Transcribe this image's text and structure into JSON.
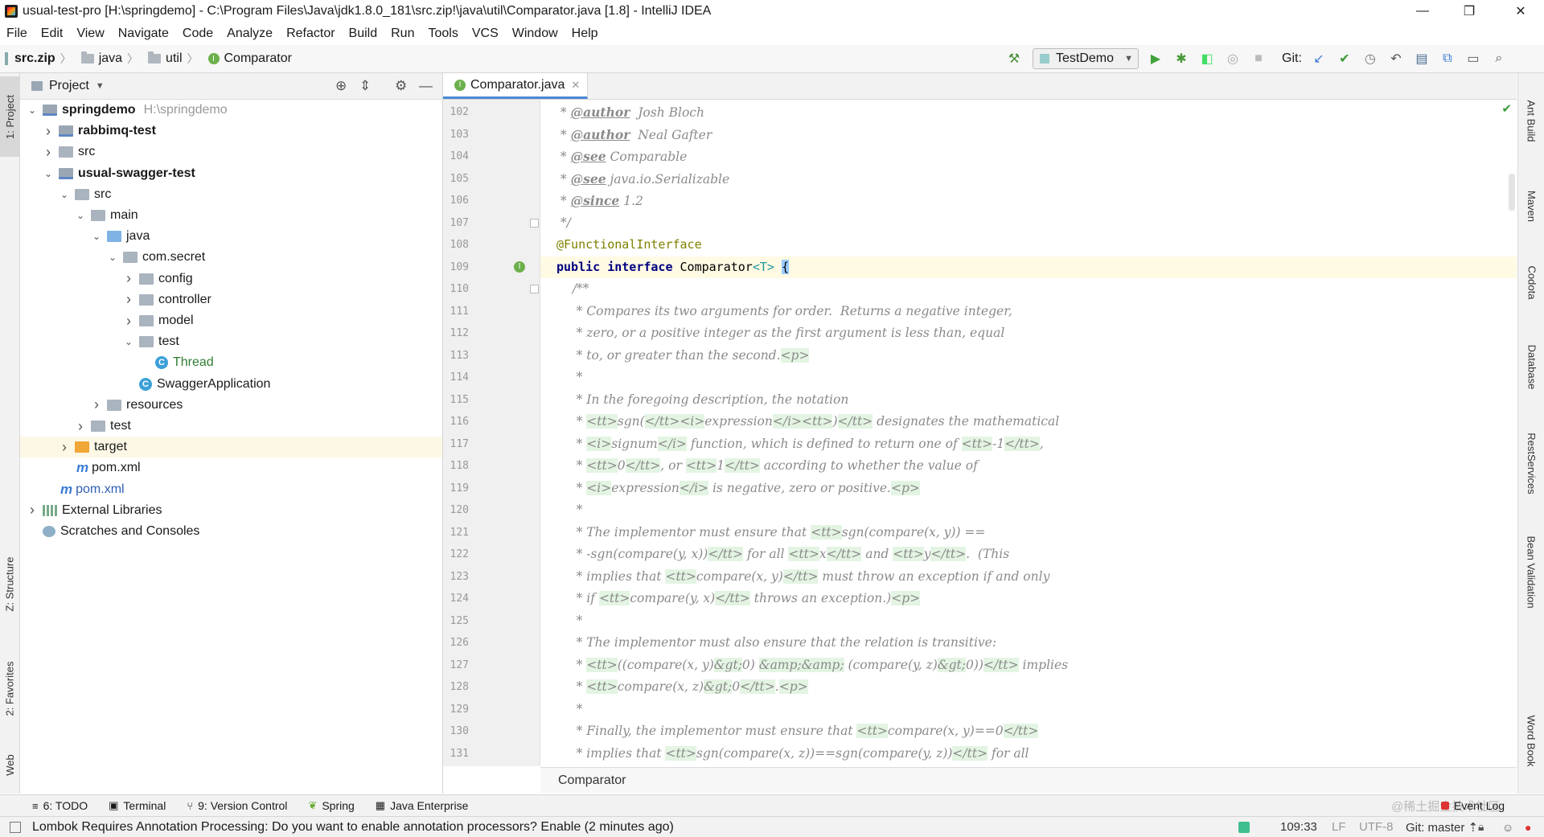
{
  "window": {
    "title": "usual-test-pro [H:\\springdemo] - C:\\Program Files\\Java\\jdk1.8.0_181\\src.zip!\\java\\util\\Comparator.java [1.8] - IntelliJ IDEA",
    "minimize": "—",
    "maximize": "❐",
    "close": "✕"
  },
  "menu": [
    "File",
    "Edit",
    "View",
    "Navigate",
    "Code",
    "Analyze",
    "Refactor",
    "Build",
    "Run",
    "Tools",
    "VCS",
    "Window",
    "Help"
  ],
  "nav": {
    "crumbs": [
      "src.zip",
      "java",
      "util",
      "Comparator"
    ],
    "run_config": "TestDemo",
    "git_label": "Git:"
  },
  "left_tools": [
    "1: Project",
    "Z: Structure",
    "2: Favorites",
    "Web"
  ],
  "project": {
    "header": "Project",
    "tree": [
      {
        "label": "springdemo",
        "extra": "H:\\springdemo",
        "depth": 0,
        "arrow": "open",
        "icon": "module",
        "bold": true
      },
      {
        "label": "rabbimq-test",
        "depth": 1,
        "arrow": "closed",
        "icon": "module",
        "bold": true
      },
      {
        "label": "src",
        "depth": 1,
        "arrow": "closed",
        "icon": "folder"
      },
      {
        "label": "usual-swagger-test",
        "depth": 1,
        "arrow": "open",
        "icon": "module",
        "bold": true
      },
      {
        "label": "src",
        "depth": 2,
        "arrow": "open",
        "icon": "folder"
      },
      {
        "label": "main",
        "depth": 3,
        "arrow": "open",
        "icon": "folder"
      },
      {
        "label": "java",
        "depth": 4,
        "arrow": "open",
        "icon": "folder-blue"
      },
      {
        "label": "com.secret",
        "depth": 5,
        "arrow": "open",
        "icon": "folder"
      },
      {
        "label": "config",
        "depth": 6,
        "arrow": "closed",
        "icon": "folder"
      },
      {
        "label": "controller",
        "depth": 6,
        "arrow": "closed",
        "icon": "folder"
      },
      {
        "label": "model",
        "depth": 6,
        "arrow": "closed",
        "icon": "folder"
      },
      {
        "label": "test",
        "depth": 6,
        "arrow": "open",
        "icon": "folder"
      },
      {
        "label": "Thread",
        "depth": 7,
        "arrow": "none",
        "icon": "class",
        "color": "#2e7d32"
      },
      {
        "label": "SwaggerApplication",
        "depth": 6,
        "arrow": "none",
        "icon": "class"
      },
      {
        "label": "resources",
        "depth": 4,
        "arrow": "closed",
        "icon": "folder"
      },
      {
        "label": "test",
        "depth": 3,
        "arrow": "closed",
        "icon": "folder"
      },
      {
        "label": "target",
        "depth": 2,
        "arrow": "closed",
        "icon": "folder-orange",
        "selected": true
      },
      {
        "label": "pom.xml",
        "depth": 2,
        "arrow": "none",
        "icon": "maven"
      },
      {
        "label": "pom.xml",
        "depth": 1,
        "arrow": "none",
        "icon": "maven",
        "color": "#2f5fb3"
      },
      {
        "label": "External Libraries",
        "depth": 0,
        "arrow": "closed",
        "icon": "libs"
      },
      {
        "label": "Scratches and Consoles",
        "depth": 0,
        "arrow": "none",
        "icon": "scratch"
      }
    ]
  },
  "editor": {
    "tab": "Comparator.java",
    "current_line": 109,
    "lines": [
      {
        "n": 102,
        "text": " * @author  Josh Bloch"
      },
      {
        "n": 103,
        "text": " * @author  Neal Gafter"
      },
      {
        "n": 104,
        "text": " * @see Comparable"
      },
      {
        "n": 105,
        "text": " * @see java.io.Serializable"
      },
      {
        "n": 106,
        "text": " * @since 1.2"
      },
      {
        "n": 107,
        "text": " */"
      },
      {
        "n": 108,
        "text": "@FunctionalInterface"
      },
      {
        "n": 109,
        "text": "public interface Comparator<T> {"
      },
      {
        "n": 110,
        "text": "    /**"
      },
      {
        "n": 111,
        "text": "     * Compares its two arguments for order.  Returns a negative integer,"
      },
      {
        "n": 112,
        "text": "     * zero, or a positive integer as the first argument is less than, equal"
      },
      {
        "n": 113,
        "text": "     * to, or greater than the second.<p>"
      },
      {
        "n": 114,
        "text": "     *"
      },
      {
        "n": 115,
        "text": "     * In the foregoing description, the notation"
      },
      {
        "n": 116,
        "text": "     * <tt>sgn(</tt><i>expression</i><tt>)</tt> designates the mathematical"
      },
      {
        "n": 117,
        "text": "     * <i>signum</i> function, which is defined to return one of <tt>-1</tt>,"
      },
      {
        "n": 118,
        "text": "     * <tt>0</tt>, or <tt>1</tt> according to whether the value of"
      },
      {
        "n": 119,
        "text": "     * <i>expression</i> is negative, zero or positive.<p>"
      },
      {
        "n": 120,
        "text": "     *"
      },
      {
        "n": 121,
        "text": "     * The implementor must ensure that <tt>sgn(compare(x, y)) =="
      },
      {
        "n": 122,
        "text": "     * -sgn(compare(y, x))</tt> for all <tt>x</tt> and <tt>y</tt>.  (This"
      },
      {
        "n": 123,
        "text": "     * implies that <tt>compare(x, y)</tt> must throw an exception if and only"
      },
      {
        "n": 124,
        "text": "     * if <tt>compare(y, x)</tt> throws an exception.)<p>"
      },
      {
        "n": 125,
        "text": "     *"
      },
      {
        "n": 126,
        "text": "     * The implementor must also ensure that the relation is transitive:"
      },
      {
        "n": 127,
        "text": "     * <tt>((compare(x, y)&gt;0) &amp;&amp; (compare(y, z)&gt;0))</tt> implies"
      },
      {
        "n": 128,
        "text": "     * <tt>compare(x, z)&gt;0</tt>.<p>"
      },
      {
        "n": 129,
        "text": "     *"
      },
      {
        "n": 130,
        "text": "     * Finally, the implementor must ensure that <tt>compare(x, y)==0</tt>"
      },
      {
        "n": 131,
        "text": "     * implies that <tt>sgn(compare(x, z))==sgn(compare(y, z))</tt> for all"
      }
    ],
    "breadcrumb": "Comparator"
  },
  "right_tools": [
    "Ant Build",
    "Maven",
    "Codota",
    "Database",
    "RestServices",
    "Bean Validation",
    "Word Book"
  ],
  "bottom_tools": [
    {
      "label": "6: TODO",
      "icon": "≡"
    },
    {
      "label": "Terminal",
      "icon": "▣"
    },
    {
      "label": "9: Version Control",
      "icon": "⑂"
    },
    {
      "label": "Spring",
      "icon": "❦"
    },
    {
      "label": "Java Enterprise",
      "icon": "▦"
    }
  ],
  "event_log": "Event Log",
  "watermark": "@稀土掘金技术社区",
  "status": {
    "message": "Lombok Requires Annotation Processing: Do you want to enable annotation processors? Enable (2 minutes ago)",
    "position": "109:33",
    "line_sep": "LF",
    "encoding": "UTF-8",
    "git": "Git: master ⇡"
  }
}
